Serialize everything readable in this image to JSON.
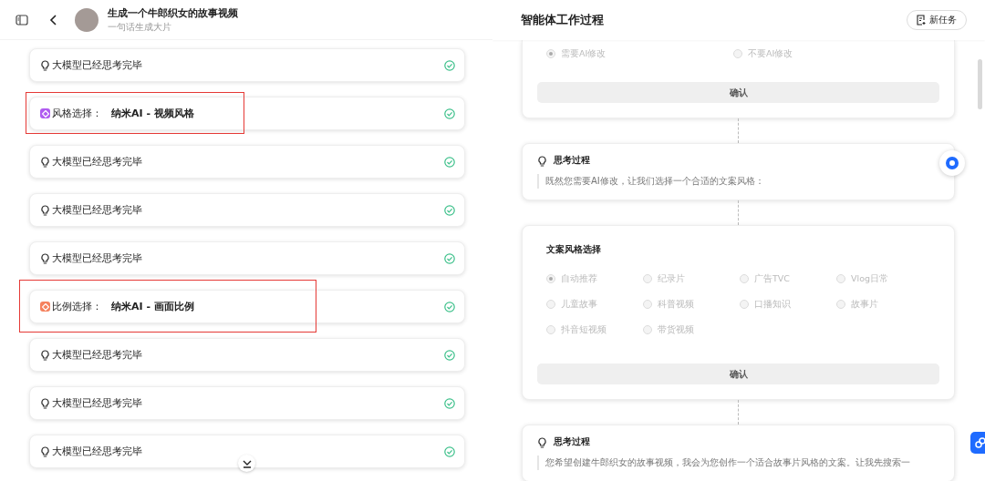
{
  "header": {
    "title": "生成一个牛郎织女的故事视频",
    "subtitle": "一句话生成大片"
  },
  "left_steps": [
    {
      "kind": "thought",
      "label": "大模型已经思考完毕",
      "done": true,
      "highlighted": false
    },
    {
      "kind": "tool",
      "label": "风格选择：",
      "value": "纳米AI - 视频风格",
      "color": "#b05cf0",
      "done": true,
      "highlighted": true
    },
    {
      "kind": "thought",
      "label": "大模型已经思考完毕",
      "done": true,
      "highlighted": false
    },
    {
      "kind": "thought",
      "label": "大模型已经思考完毕",
      "done": true,
      "highlighted": false
    },
    {
      "kind": "thought",
      "label": "大模型已经思考完毕",
      "done": true,
      "highlighted": false
    },
    {
      "kind": "tool",
      "label": "比例选择：",
      "value": "纳米AI - 画面比例",
      "color": "#f5825e",
      "done": true,
      "highlighted": true
    },
    {
      "kind": "thought",
      "label": "大模型已经思考完毕",
      "done": true,
      "highlighted": false
    },
    {
      "kind": "thought",
      "label": "大模型已经思考完毕",
      "done": true,
      "highlighted": false
    },
    {
      "kind": "thought",
      "label": "大模型已经思考完毕",
      "done": true,
      "highlighted": false
    }
  ],
  "right": {
    "title": "智能体工作过程",
    "new_task_button": "新任务"
  },
  "flow": [
    {
      "kind": "choice",
      "options": [
        {
          "label": "需要AI修改",
          "selected": true
        },
        {
          "label": "不要AI修改",
          "selected": false
        }
      ],
      "button": "确认"
    },
    {
      "kind": "thought",
      "title": "思考过程",
      "text": "既然您需要AI修改，让我们选择一个合适的文案风格："
    },
    {
      "kind": "choice",
      "title": "文案风格选择",
      "options": [
        {
          "label": "自动推荐",
          "selected": true
        },
        {
          "label": "纪录片",
          "selected": false
        },
        {
          "label": "广告TVC",
          "selected": false
        },
        {
          "label": "Vlog日常",
          "selected": false
        },
        {
          "label": "儿童故事",
          "selected": false
        },
        {
          "label": "科普视频",
          "selected": false
        },
        {
          "label": "口播知识",
          "selected": false
        },
        {
          "label": "故事片",
          "selected": false
        },
        {
          "label": "抖音短视频",
          "selected": false
        },
        {
          "label": "带货视频",
          "selected": false
        }
      ],
      "button": "确认"
    },
    {
      "kind": "thought",
      "title": "思考过程",
      "text": "您希望创建牛郎织女的故事视频，我会为您创作一个适合故事片风格的文案。让我先搜索一"
    }
  ]
}
